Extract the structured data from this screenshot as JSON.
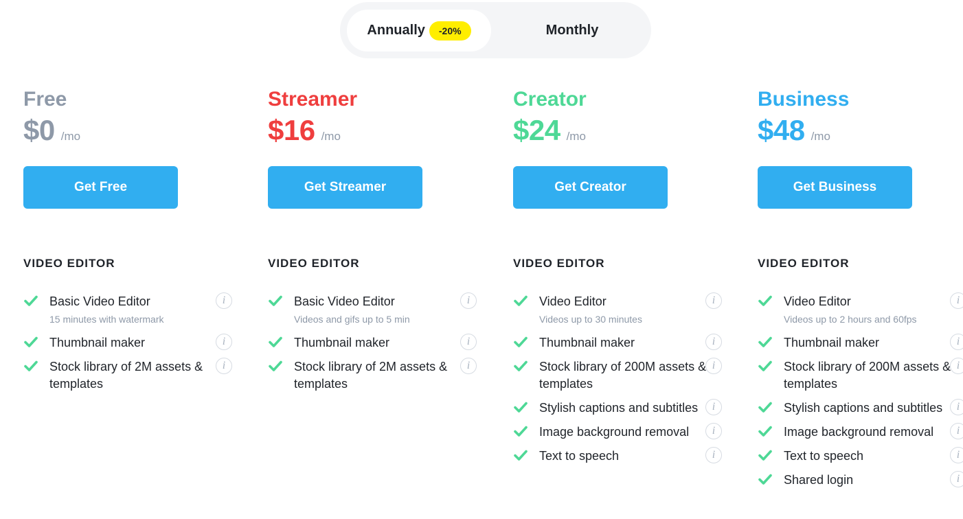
{
  "billing_toggle": {
    "annual_label": "Annually",
    "annual_badge": "-20%",
    "monthly_label": "Monthly",
    "selected": "Annually"
  },
  "colors": {
    "free": "#8e99a8",
    "streamer": "#ef3e3e",
    "creator": "#4ed896",
    "business": "#31aef0",
    "cta": "#31aef0",
    "check": "#4ed896",
    "badge": "#ffee00"
  },
  "plans": [
    {
      "name": "Free",
      "price": "$0",
      "per": "/mo",
      "cta": "Get Free",
      "section": "VIDEO EDITOR",
      "features": [
        {
          "title": "Basic Video Editor",
          "sub": "15 minutes with watermark"
        },
        {
          "title": "Thumbnail maker"
        },
        {
          "title": "Stock library of 2M assets & templates"
        }
      ]
    },
    {
      "name": "Streamer",
      "price": "$16",
      "per": "/mo",
      "cta": "Get Streamer",
      "section": "VIDEO EDITOR",
      "features": [
        {
          "title": "Basic Video Editor",
          "sub": "Videos and gifs up to 5 min"
        },
        {
          "title": "Thumbnail maker"
        },
        {
          "title": "Stock library of 2M assets & templates"
        }
      ]
    },
    {
      "name": "Creator",
      "price": "$24",
      "per": "/mo",
      "cta": "Get Creator",
      "section": "VIDEO EDITOR",
      "features": [
        {
          "title": "Video Editor",
          "sub": "Videos up to 30 minutes"
        },
        {
          "title": "Thumbnail maker"
        },
        {
          "title": "Stock library of 200M assets & templates"
        },
        {
          "title": "Stylish captions and subtitles"
        },
        {
          "title": "Image background removal"
        },
        {
          "title": "Text to speech"
        }
      ]
    },
    {
      "name": "Business",
      "price": "$48",
      "per": "/mo",
      "cta": "Get Business",
      "section": "VIDEO EDITOR",
      "features": [
        {
          "title": "Video Editor",
          "sub": "Videos up to 2 hours and 60fps"
        },
        {
          "title": "Thumbnail maker"
        },
        {
          "title": "Stock library of 200M assets & templates"
        },
        {
          "title": "Stylish captions and subtitles"
        },
        {
          "title": "Image background removal"
        },
        {
          "title": "Text to speech"
        },
        {
          "title": "Shared login"
        }
      ]
    }
  ],
  "icons": {
    "check": "check-icon",
    "info": "info-icon",
    "info_glyph": "i"
  }
}
